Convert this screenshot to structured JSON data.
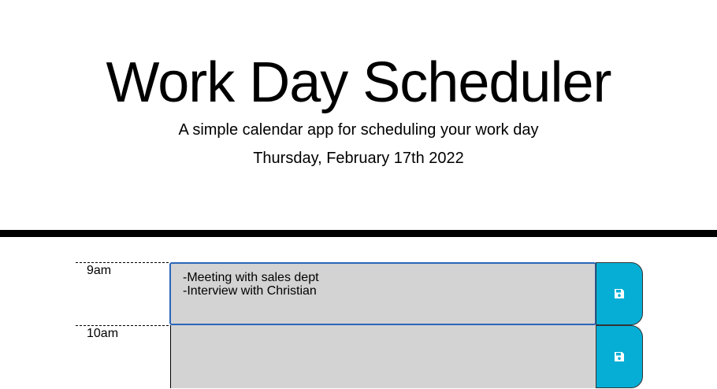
{
  "header": {
    "title": "Work Day Scheduler",
    "subtitle": "A simple calendar app for scheduling your work day",
    "current_day": "Thursday, February 17th 2022"
  },
  "time_blocks": [
    {
      "hour": "9am",
      "text": "-Meeting with sales dept\n-Interview with Christian",
      "save_icon": "floppy-disk-icon"
    },
    {
      "hour": "10am",
      "text": "",
      "save_icon": "floppy-disk-icon"
    }
  ],
  "colors": {
    "past_block": "#d3d3d3",
    "save_button": "#06aed5",
    "divider": "#000000",
    "focus_border": "#2a66b8"
  }
}
